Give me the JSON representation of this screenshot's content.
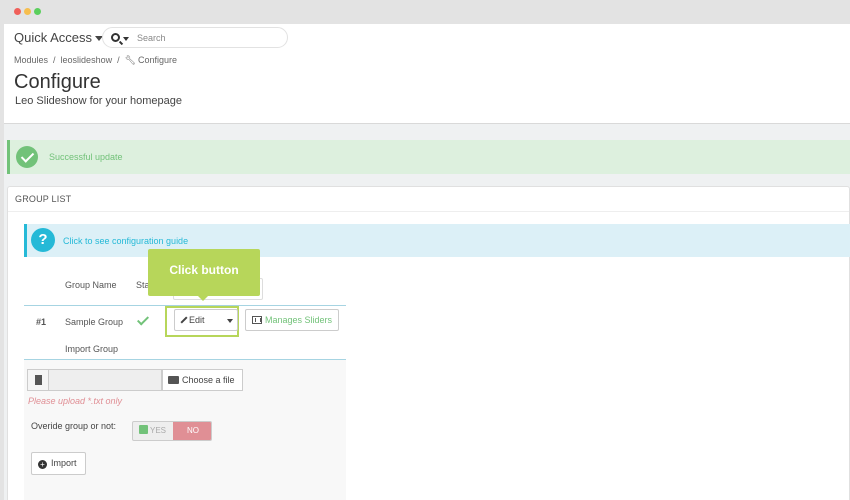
{
  "header": {
    "quick_access": "Quick Access",
    "search_placeholder": "Search",
    "breadcrumb": [
      "Modules",
      "leoslideshow",
      "Configure"
    ],
    "breadcrumb_sep": "/",
    "title": "Configure",
    "subtitle": "Leo Slideshow for your homepage"
  },
  "alerts": {
    "success": "Successful update",
    "info_link": "Click to see configuration guide",
    "info_icon": "?"
  },
  "group_list": {
    "heading": "GROUP LIST",
    "columns": {
      "group_name": "Group Name",
      "status": "Sta"
    },
    "rows": [
      {
        "id": "#1",
        "name": "Sample Group",
        "status": "enabled"
      }
    ],
    "edit_label": "Edit",
    "manage_label": "Manages Sliders"
  },
  "tooltip": "Click button",
  "import": {
    "label": "Import Group",
    "choose_file": "Choose a file",
    "help": "Please upload *.txt only",
    "override_label": "Overide group or not:",
    "yes": "YES",
    "no": "NO",
    "import_button": "Import",
    "plus_icon": "+"
  },
  "colors": {
    "success": "#72c279",
    "info": "#25b9d7",
    "highlight": "#b7d65a",
    "danger": "#e08f95"
  },
  "icons": [
    "search-icon",
    "wrench-icon",
    "check-circle-icon",
    "question-circle-icon",
    "pencil-icon",
    "film-icon",
    "file-icon",
    "folder-open-icon",
    "check-box-icon",
    "plus-circle-icon"
  ]
}
